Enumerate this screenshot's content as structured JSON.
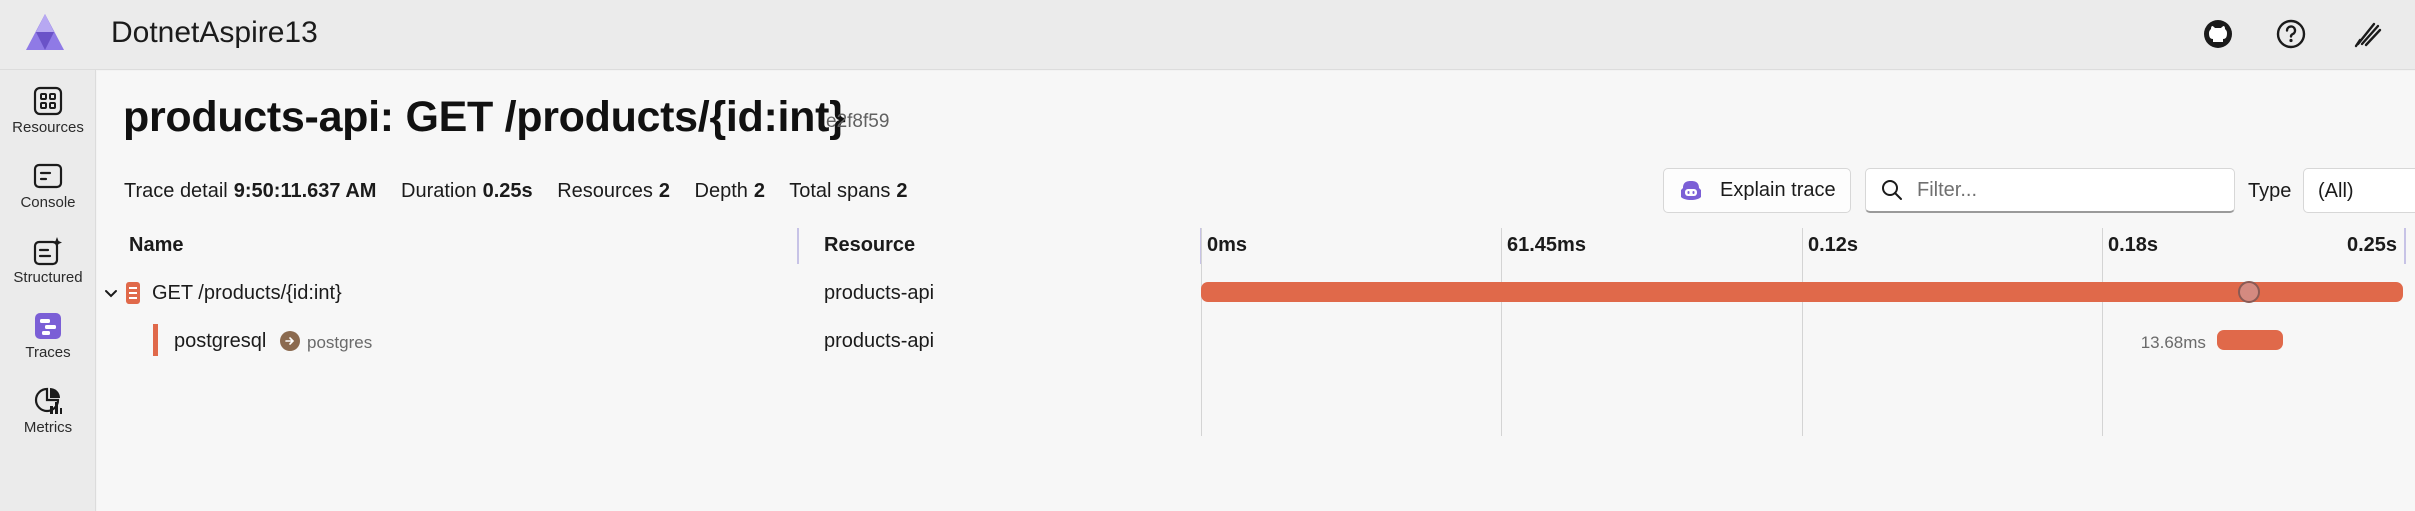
{
  "app": {
    "title": "DotnetAspire13"
  },
  "sidebar": {
    "items": [
      {
        "label": "Resources",
        "icon": "resources-icon"
      },
      {
        "label": "Console",
        "icon": "console-icon"
      },
      {
        "label": "Structured",
        "icon": "structured-icon"
      },
      {
        "label": "Traces",
        "icon": "traces-icon",
        "active": true
      },
      {
        "label": "Metrics",
        "icon": "metrics-icon"
      }
    ]
  },
  "header_icons": [
    "github-icon",
    "help-icon",
    "settings-icon"
  ],
  "page": {
    "title": "products-api: GET /products/{id:int}",
    "trace_id": "e2f8f59"
  },
  "trace_meta": {
    "detail_label": "Trace detail",
    "detail_value": "9:50:11.637 AM",
    "duration_label": "Duration",
    "duration_value": "0.25s",
    "resources_label": "Resources",
    "resources_value": "2",
    "depth_label": "Depth",
    "depth_value": "2",
    "spans_label": "Total spans",
    "spans_value": "2"
  },
  "toolbar": {
    "explain_label": "Explain trace",
    "filter_placeholder": "Filter...",
    "type_label": "Type",
    "type_value": "(All)"
  },
  "table": {
    "columns": {
      "name": "Name",
      "resource": "Resource"
    },
    "ticks": [
      "0ms",
      "61.45ms",
      "0.12s",
      "0.18s",
      "0.25s"
    ],
    "rows": [
      {
        "name": "GET /products/{id:int}",
        "resource": "products-api",
        "start_fraction": 0.0,
        "end_fraction": 1.0,
        "event_fraction": 0.872
      },
      {
        "name": "postgresql",
        "target": "postgres",
        "resource": "products-api",
        "start_fraction": 0.845,
        "end_fraction": 0.9,
        "duration_label": "13.68ms"
      }
    ]
  },
  "colors": {
    "accent": "#7b5fd6",
    "span_bar": "#e0694a"
  }
}
